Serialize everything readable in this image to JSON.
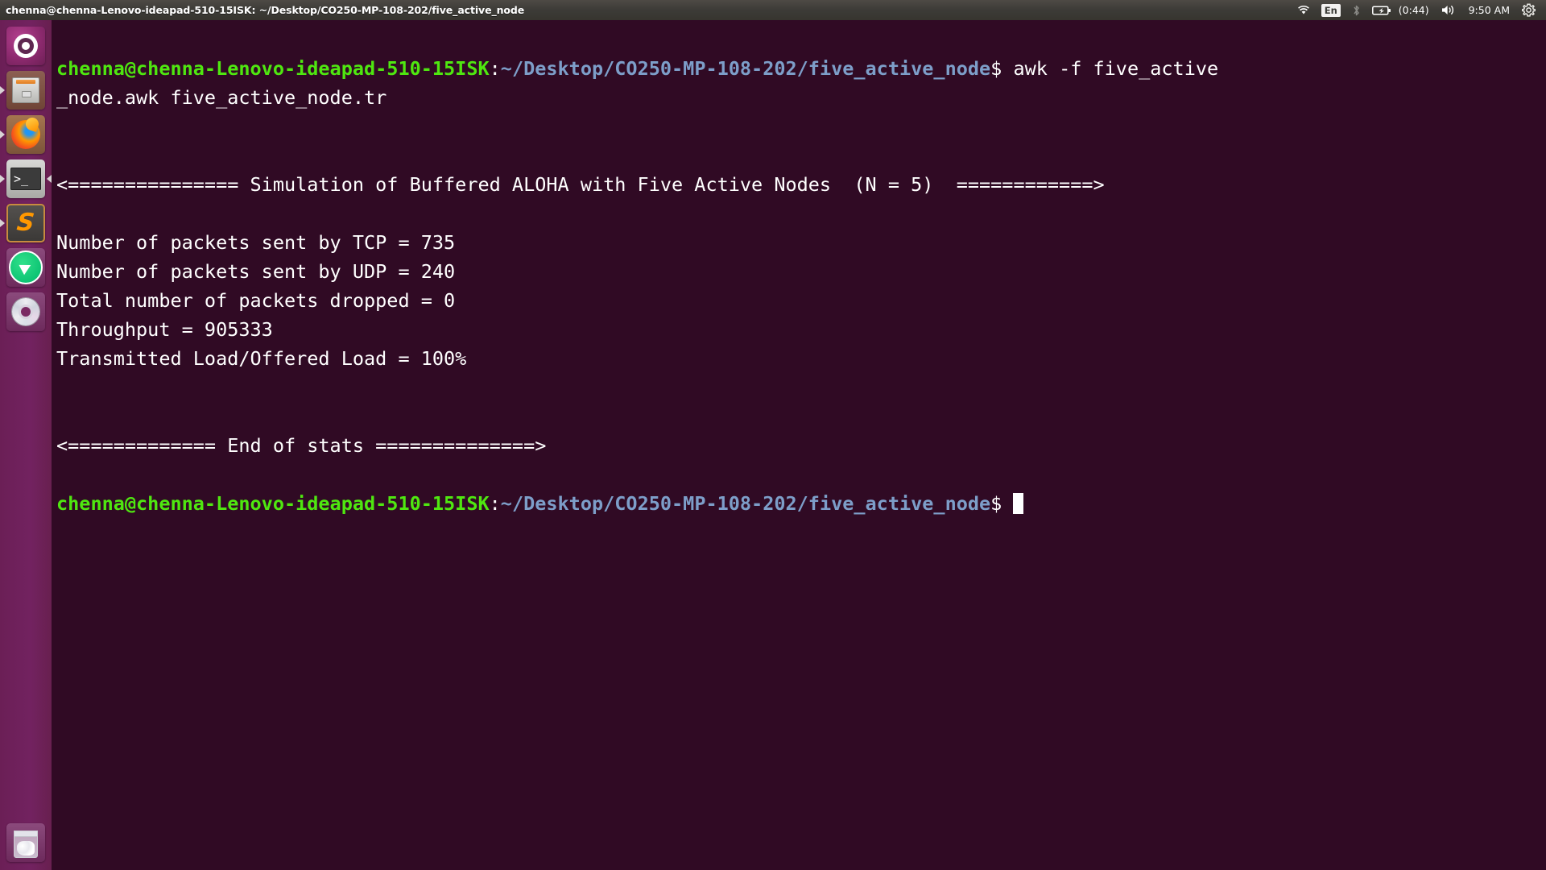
{
  "window": {
    "title": "chenna@chenna-Lenovo-ideapad-510-15ISK: ~/Desktop/CO250-MP-108-202/five_active_node"
  },
  "tray": {
    "wifi_icon": "wifi-icon",
    "keyboard_layout": "En",
    "bluetooth_icon": "bluetooth-icon",
    "battery_icon": "battery-icon",
    "battery_time": "(0:44)",
    "volume_icon": "volume-icon",
    "clock": "9:50 AM",
    "session_icon": "gear-icon"
  },
  "launcher": {
    "items": [
      {
        "name": "ubuntu-dash",
        "label": "Dash home",
        "running": false,
        "focused": false
      },
      {
        "name": "files",
        "label": "Files",
        "running": true,
        "focused": false
      },
      {
        "name": "firefox",
        "label": "Firefox Web Browser",
        "running": true,
        "focused": false
      },
      {
        "name": "terminal",
        "label": "Terminal",
        "running": true,
        "focused": false
      },
      {
        "name": "sublime-text",
        "label": "Sublime Text",
        "running": true,
        "focused": true
      },
      {
        "name": "telegram",
        "label": "Telegram",
        "running": false,
        "focused": false
      },
      {
        "name": "disc",
        "label": "Disc Writer",
        "running": false,
        "focused": false
      }
    ],
    "trash": {
      "name": "trash",
      "label": "Trash"
    }
  },
  "terminal": {
    "prompt": {
      "user_host": "chenna@chenna-Lenovo-ideapad-510-15ISK",
      "separator": ":",
      "path": "~/Desktop/CO250-MP-108-202/five_active_node",
      "sigil": "$"
    },
    "command_part1": " awk -f five_active",
    "command_part2": "_node.awk five_active_node.tr",
    "output": {
      "header": "<=============== Simulation of Buffered ALOHA with Five Active Nodes  (N = 5)  ============>",
      "stats": [
        "Number of packets sent by TCP = 735",
        "Number of packets sent by UDP = 240",
        "Total number of packets dropped = 0",
        "Throughput = 905333",
        "Transmitted Load/Offered Load = 100%"
      ],
      "footer": "<============= End of stats ==============>"
    }
  },
  "colors": {
    "terminal_background": "#300a24",
    "prompt_user_host": "#4fe710",
    "prompt_path": "#7d9ec9",
    "text": "#ffffff",
    "launcher_background": "#6e2059",
    "panel_background": "#3c3b37"
  }
}
